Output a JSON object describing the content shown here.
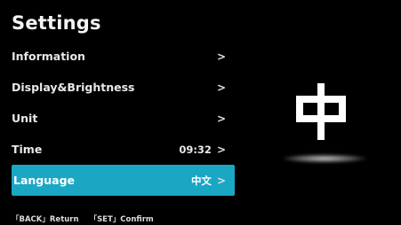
{
  "title": "Settings",
  "menu": [
    {
      "label": "Information",
      "value": "",
      "chevron": ">"
    },
    {
      "label": "Display&Brightness",
      "value": "",
      "chevron": ">"
    },
    {
      "label": "Unit",
      "value": "",
      "chevron": ">"
    },
    {
      "label": "Time",
      "value": "09:32",
      "chevron": ">"
    },
    {
      "label": "Language",
      "value": "中文",
      "chevron": ">"
    }
  ],
  "footer": {
    "back": "「BACK」Return",
    "set": "「SET」Confirm"
  },
  "preview": {
    "glyph": "中"
  },
  "colors": {
    "background": "#000000",
    "selected": "#1aa7c4",
    "text": "#ffffff"
  }
}
